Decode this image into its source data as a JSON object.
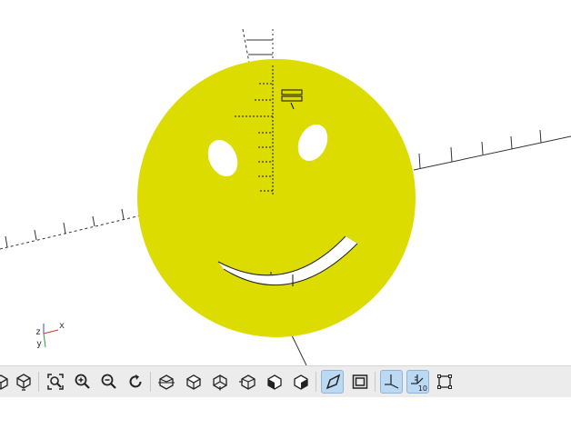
{
  "viewport": {
    "model_color": "#dcdc00",
    "background_color": "#ffffff",
    "axis_color": "#333333",
    "cross_section_color": "#000000"
  },
  "axes_indicator": {
    "x_label": "x",
    "y_label": "y",
    "z_label": "z",
    "x_color": "#d9302f",
    "y_color": "#2ea043",
    "z_color": "#2f55d9"
  },
  "toolbar": {
    "buttons": [
      {
        "icon": "render-icon",
        "active": false
      },
      {
        "icon": "preview-icon",
        "active": false
      },
      {
        "icon": "view-all-icon",
        "active": false
      },
      {
        "icon": "zoom-in-icon",
        "active": false
      },
      {
        "icon": "zoom-out-icon",
        "active": false
      },
      {
        "icon": "reset-view-icon",
        "active": false
      },
      {
        "icon": "view-right-icon",
        "active": false
      },
      {
        "icon": "view-top-icon",
        "active": false
      },
      {
        "icon": "view-bottom-icon",
        "active": false
      },
      {
        "icon": "view-left-icon",
        "active": false
      },
      {
        "icon": "view-front-icon",
        "active": false
      },
      {
        "icon": "view-back-icon",
        "active": false
      },
      {
        "icon": "perspective-icon",
        "active": true
      },
      {
        "icon": "orthogonal-icon",
        "active": false
      },
      {
        "icon": "show-axes-icon",
        "active": true
      },
      {
        "icon": "show-scale-markers-icon",
        "active": true
      },
      {
        "icon": "show-edges-icon",
        "active": false
      }
    ],
    "scale_marker_label": "10",
    "active_color": "#bcd9f3"
  }
}
